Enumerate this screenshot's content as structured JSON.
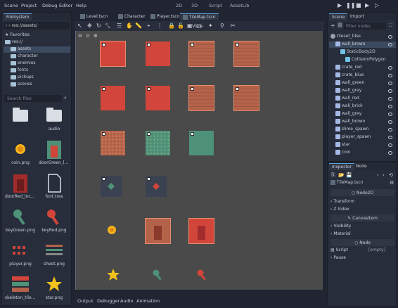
{
  "menu": {
    "items": [
      "Scene",
      "Project",
      "Debug",
      "Editor",
      "Help"
    ],
    "modes": [
      "2D",
      "3D",
      "Script",
      "AssetLib"
    ]
  },
  "filesystem": {
    "title": "FileSystem",
    "path": "res://assets/",
    "tree": [
      {
        "label": "Favorites:",
        "level": 0,
        "type": "star"
      },
      {
        "label": "res://",
        "level": 0,
        "type": "folder"
      },
      {
        "label": "assets",
        "level": 1,
        "type": "folder",
        "selected": true
      },
      {
        "label": "character",
        "level": 1,
        "type": "folder"
      },
      {
        "label": "enemies",
        "level": 1,
        "type": "folder"
      },
      {
        "label": "fonts",
        "level": 1,
        "type": "folder"
      },
      {
        "label": "pickups",
        "level": 1,
        "type": "folder"
      },
      {
        "label": "scenes",
        "level": 1,
        "type": "folder"
      }
    ],
    "search_placeholder": "Search files",
    "files": [
      {
        "name": "",
        "kind": "folder"
      },
      {
        "name": "audio",
        "kind": "folder"
      },
      {
        "name": "coin.png",
        "kind": "coin"
      },
      {
        "name": "doorGreen_lock.png",
        "kind": "door-green"
      },
      {
        "name": "doorRed_lock.png",
        "kind": "door-red"
      },
      {
        "name": "font.tres",
        "kind": "file"
      },
      {
        "name": "keyGreen.png",
        "kind": "key-green"
      },
      {
        "name": "keyRed.png",
        "kind": "key-red"
      },
      {
        "name": "player.png",
        "kind": "player"
      },
      {
        "name": "sheet.png",
        "kind": "sheet"
      },
      {
        "name": "skeleton_tileset...",
        "kind": "tileset"
      },
      {
        "name": "star.png",
        "kind": "star"
      }
    ]
  },
  "tabs": [
    {
      "label": "Level.tscn",
      "active": false
    },
    {
      "label": "Character",
      "active": false
    },
    {
      "label": "Player.tscn",
      "active": false
    },
    {
      "label": "TileMap.tscn",
      "active": true
    }
  ],
  "toolbar": {
    "view_label": "View"
  },
  "bottom_tabs": [
    "Output",
    "Debugger",
    "Audio",
    "Animation"
  ],
  "scene": {
    "tabs": [
      "Scene",
      "Import"
    ],
    "filter_placeholder": "Filter nodes",
    "nodes": [
      {
        "label": "tileset_tiles",
        "level": 0,
        "icon": "node2d"
      },
      {
        "label": "wall_brown",
        "level": 1,
        "icon": "sprite",
        "selected": true
      },
      {
        "label": "StaticBody2D",
        "level": 2,
        "icon": "body"
      },
      {
        "label": "CollisionPolygon",
        "level": 3,
        "icon": "collision"
      },
      {
        "label": "crate_red",
        "level": 1,
        "icon": "sprite"
      },
      {
        "label": "crate_blue",
        "level": 1,
        "icon": "sprite"
      },
      {
        "label": "wall_green",
        "level": 1,
        "icon": "sprite"
      },
      {
        "label": "wall_grey",
        "level": 1,
        "icon": "sprite"
      },
      {
        "label": "wall_red",
        "level": 1,
        "icon": "sprite"
      },
      {
        "label": "wall_brick",
        "level": 1,
        "icon": "sprite"
      },
      {
        "label": "wall_grey",
        "level": 1,
        "icon": "sprite"
      },
      {
        "label": "wall_brown",
        "level": 1,
        "icon": "sprite"
      },
      {
        "label": "slime_spawn",
        "level": 1,
        "icon": "sprite"
      },
      {
        "label": "player_spawn",
        "level": 1,
        "icon": "sprite"
      },
      {
        "label": "star",
        "level": 1,
        "icon": "sprite"
      },
      {
        "label": "coin",
        "level": 1,
        "icon": "sprite"
      }
    ]
  },
  "inspector": {
    "tabs": [
      "Inspector",
      "Node"
    ],
    "node_name": "TileMap.tscn",
    "class_label": "Node2D",
    "sections": [
      "Transform",
      "Z Index"
    ],
    "canvas_label": "CanvasItem",
    "sections2": [
      "Visibility",
      "Material"
    ],
    "node_label": "Node",
    "script_label": "Script",
    "script_value": "[empty]",
    "pause_label": "Pause"
  },
  "colors": {
    "accent": "#5ea1d9",
    "red_tile": "#d2453a",
    "teal_tile": "#4e9179",
    "brown_tile": "#b5624a"
  }
}
